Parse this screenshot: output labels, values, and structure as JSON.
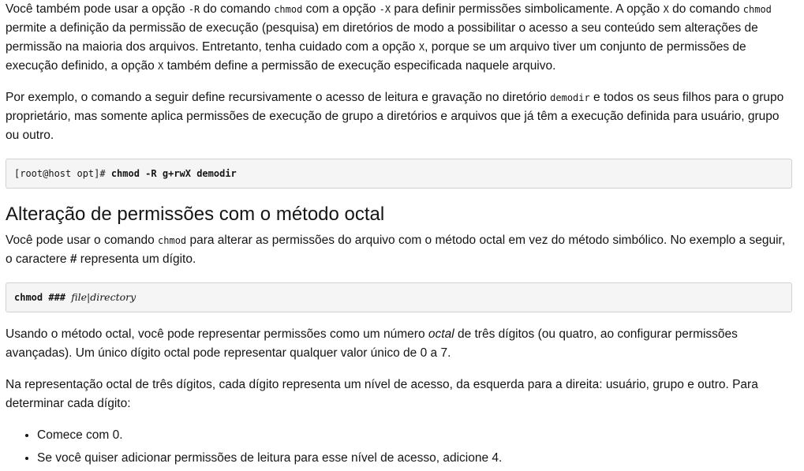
{
  "para1": {
    "t1": "Você também pode usar a opção ",
    "c1": "-R",
    "t2": " do comando ",
    "c2": "chmod",
    "t3": " com a opção ",
    "c3": "-X",
    "t4": " para definir permissões simbolicamente. A opção ",
    "c4": "X",
    "t5": " do comando ",
    "c5": "chmod",
    "t6": " permite a definição da permissão de execução (pesquisa) em diretórios de modo a possibilitar o acesso a seu conteúdo sem alterações de permissão na maioria dos arquivos. Entretanto, tenha cuidado com a opção ",
    "c6": "X",
    "t7": ", porque se um arquivo tiver um conjunto de permissões de execução definido, a opção ",
    "c7": "X",
    "t8": " também define a permissão de execução especificada naquele arquivo."
  },
  "para2": {
    "t1": "Por exemplo, o comando a seguir define recursivamente o acesso de leitura e gravação no diretório ",
    "c1": "demodir",
    "t2": " e todos os seus filhos para o grupo proprietário, mas somente aplica permissões de execução de grupo a diretórios e arquivos que já têm a execução definida para usuário, grupo ou outro."
  },
  "code1": {
    "prompt": "[root@host opt]# ",
    "command": "chmod -R g+rwX demodir"
  },
  "heading": "Alteração de permissões com o método octal",
  "para3": {
    "t1": "Você pode usar o comando ",
    "c1": "chmod",
    "t2": " para alterar as permissões do arquivo com o método octal em vez do método simbólico. No exemplo a seguir, o caractere ",
    "b1": "#",
    "t3": " representa um dígito."
  },
  "code2": {
    "command": "chmod ### ",
    "arg": "file|directory"
  },
  "para4": {
    "t1": "Usando o método octal, você pode representar permissões como um número ",
    "em1": "octal",
    "t2": " de três dígitos (ou quatro, ao configurar permissões avançadas). Um único dígito octal pode representar qualquer valor único de 0 a 7."
  },
  "para5": {
    "text": "Na representação octal de três dígitos, cada dígito representa um nível de acesso, da esquerda para a direita: usuário, grupo e outro. Para determinar cada dígito:"
  },
  "list": [
    "Comece com 0.",
    "Se você quiser adicionar permissões de leitura para esse nível de acesso, adicione 4."
  ]
}
